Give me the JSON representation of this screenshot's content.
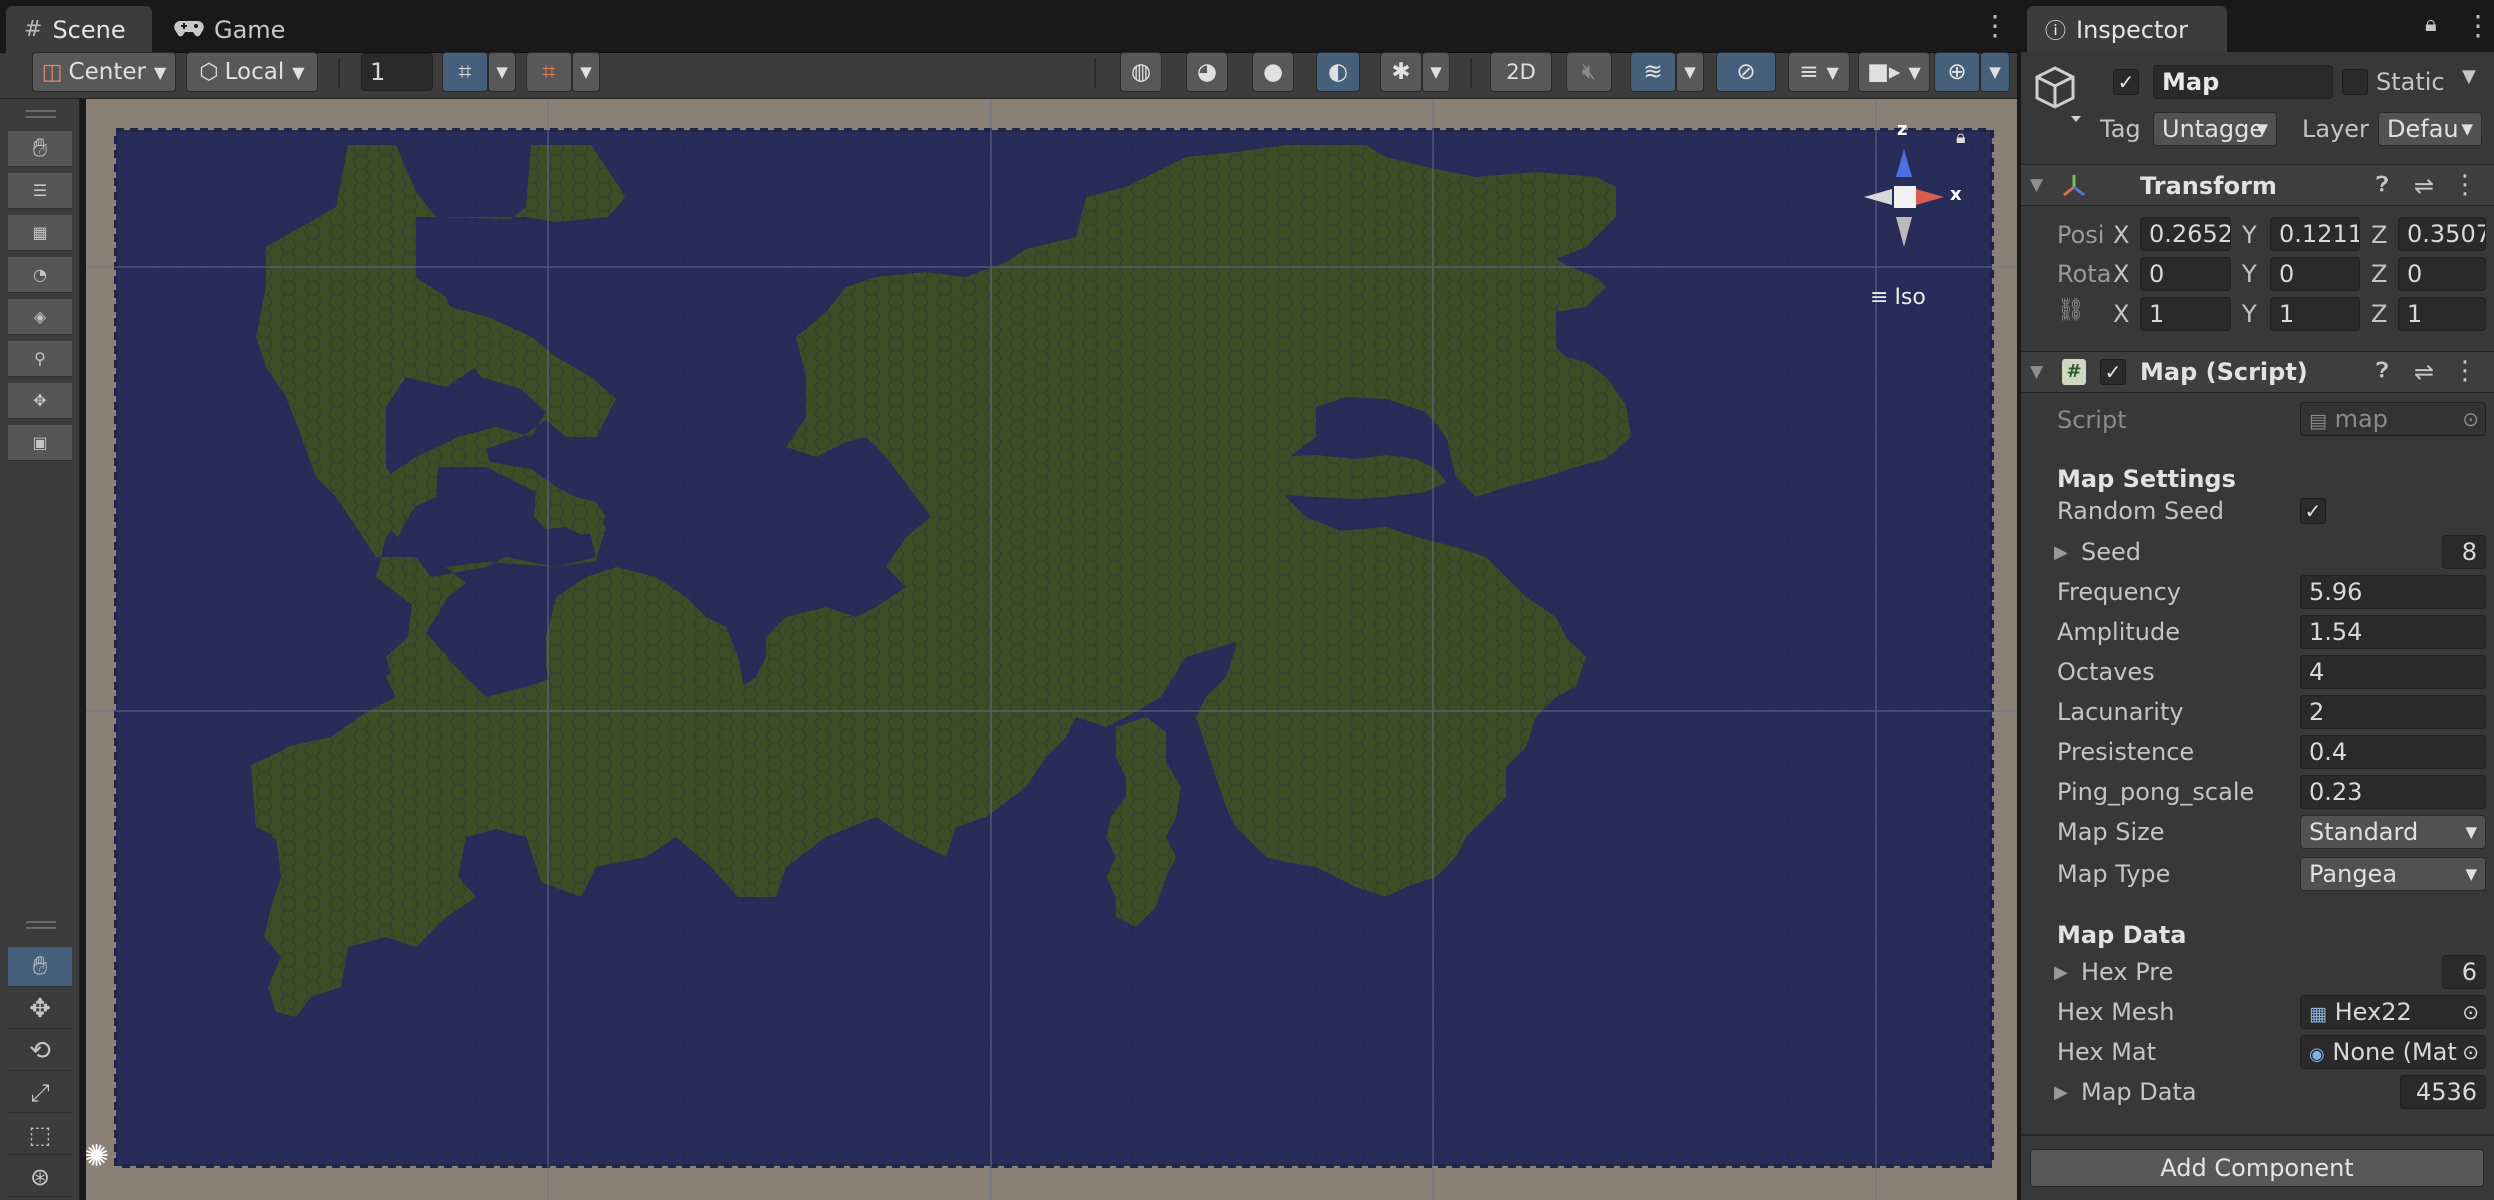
{
  "tabs": {
    "scene_label": "Scene",
    "game_label": "Game",
    "inspector_label": "Inspector"
  },
  "toolbar": {
    "pivot": "Center",
    "space": "Local",
    "grid_value": "1",
    "toggle_2d": "2D"
  },
  "gizmo": {
    "axis_z": "z",
    "axis_x": "x",
    "projection": "Iso"
  },
  "inspector": {
    "object_name": "Map",
    "static_label": "Static",
    "tag_label": "Tag",
    "tag_value": "Untagge",
    "layer_label": "Layer",
    "layer_value": "Defau",
    "transform": {
      "title": "Transform",
      "position_label": "Posi",
      "rotation_label": "Rota",
      "axis_x": "X",
      "axis_y": "Y",
      "axis_z": "Z",
      "position": {
        "x": "0.2652",
        "y": "0.12113",
        "z": "0.3507"
      },
      "rotation": {
        "x": "0",
        "y": "0",
        "z": "0"
      },
      "scale": {
        "x": "1",
        "y": "1",
        "z": "1"
      }
    },
    "map_script": {
      "title": "Map (Script)",
      "script_label": "Script",
      "script_value": "map",
      "map_settings_header": "Map Settings",
      "random_seed_label": "Random Seed",
      "seed_label": "Seed",
      "seed_value": "8",
      "frequency_label": "Frequency",
      "frequency_value": "5.96",
      "amplitude_label": "Amplitude",
      "amplitude_value": "1.54",
      "octaves_label": "Octaves",
      "octaves_value": "4",
      "lacunarity_label": "Lacunarity",
      "lacunarity_value": "2",
      "presistence_label": "Presistence",
      "presistence_value": "0.4",
      "ping_pong_label": "Ping_pong_scale",
      "ping_pong_value": "0.23",
      "map_size_label": "Map Size",
      "map_size_value": "Standard",
      "map_type_label": "Map Type",
      "map_type_value": "Pangea",
      "map_data_header": "Map Data",
      "hex_pre_label": "Hex Pre",
      "hex_pre_value": "6",
      "hex_mesh_label": "Hex Mesh",
      "hex_mesh_value": "Hex22",
      "hex_mat_label": "Hex Mat",
      "hex_mat_value": "None (Mat",
      "map_data_label": "Map Data",
      "map_data_value": "4536"
    },
    "add_component": "Add Component"
  },
  "colors": {
    "water": "#272d58",
    "land": "#3e4d26",
    "border": "#8b8075",
    "accent_blue": "#46607c",
    "panel": "#383838"
  },
  "icons": [
    "scene-grid-icon",
    "game-controller-icon",
    "info-icon",
    "lock-icon",
    "hand-icon",
    "move-icon",
    "rotate-icon",
    "scale-icon",
    "rect-icon",
    "transform-icon",
    "gear-icon",
    "cube-icon",
    "script-icon",
    "mesh-icon",
    "material-icon",
    "target-icon"
  ]
}
